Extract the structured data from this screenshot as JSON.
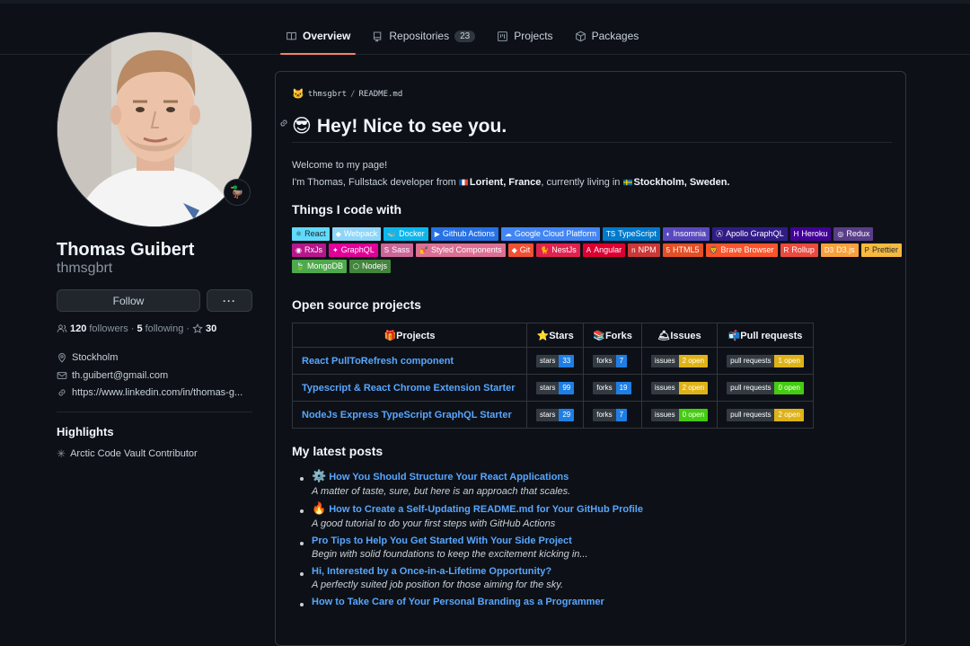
{
  "tabs": [
    {
      "label": "Overview",
      "icon": "book-icon"
    },
    {
      "label": "Repositories",
      "icon": "repo-icon",
      "count": "23"
    },
    {
      "label": "Projects",
      "icon": "project-icon"
    },
    {
      "label": "Packages",
      "icon": "package-icon"
    }
  ],
  "profile": {
    "name": "Thomas Guibert",
    "login": "thmsgbrt",
    "status_emoji": "🦆",
    "follow_label": "Follow",
    "more_label": "···",
    "followers_count": "120",
    "followers_label": "followers",
    "following_count": "5",
    "following_label": "following",
    "stars_count": "30",
    "location": "Stockholm",
    "email": "th.guibert@gmail.com",
    "website": "https://www.linkedin.com/in/thomas-g...",
    "highlights_title": "Highlights",
    "highlight_item": "Arctic Code Vault Contributor"
  },
  "readme": {
    "owner": "thmsgbrt",
    "file": "README.md",
    "heading_emoji": "😎",
    "heading": "Hey! Nice to see you.",
    "welcome": "Welcome to my page!",
    "intro_prefix": "I'm Thomas, Fullstack developer from",
    "origin": "Lorient, France",
    "intro_middle": ", currently living in",
    "current": "Stockholm, Sweden.",
    "things_title": "Things I code with",
    "badges": [
      {
        "label": "React",
        "color": "#20232a",
        "bg": "#61dafb",
        "icon": "⚛"
      },
      {
        "label": "Webpack",
        "bg": "#8dd6f9",
        "icon": "◆"
      },
      {
        "label": "Docker",
        "bg": "#0db7ed",
        "icon": "🐳"
      },
      {
        "label": "Github Actions",
        "bg": "#2671e5",
        "icon": "▶"
      },
      {
        "label": "Google Cloud Platform",
        "bg": "#4285f4",
        "icon": "☁"
      },
      {
        "label": "TypeScript",
        "bg": "#007acc",
        "icon": "TS"
      },
      {
        "label": "Insomnia",
        "bg": "#5849be",
        "icon": "◐"
      },
      {
        "label": "Apollo GraphQL",
        "bg": "#311c87",
        "icon": "Ⓐ"
      },
      {
        "label": "Heroku",
        "bg": "#430098",
        "icon": "H"
      },
      {
        "label": "Redux",
        "bg": "#593d88",
        "icon": "◎"
      },
      {
        "label": "RxJs",
        "bg": "#b7178c",
        "icon": "◉"
      },
      {
        "label": "GraphQL",
        "bg": "#e10098",
        "icon": "✦"
      },
      {
        "label": "Sass",
        "bg": "#cc6699",
        "icon": "S"
      },
      {
        "label": "Styled Components",
        "bg": "#db7093",
        "icon": "💅"
      },
      {
        "label": "Git",
        "bg": "#f05033",
        "icon": "◆"
      },
      {
        "label": "NestJs",
        "bg": "#e0234e",
        "icon": "🐈"
      },
      {
        "label": "Angular",
        "bg": "#dd0031",
        "icon": "A"
      },
      {
        "label": "NPM",
        "bg": "#cb3837",
        "icon": "n"
      },
      {
        "label": "HTML5",
        "bg": "#e34f26",
        "icon": "5"
      },
      {
        "label": "Brave Browser",
        "bg": "#fb542b",
        "icon": "🦁"
      },
      {
        "label": "Rollup",
        "bg": "#ec4a3f",
        "icon": "R"
      },
      {
        "label": "D3.js",
        "bg": "#f9a03c",
        "icon": "D3"
      },
      {
        "label": "Prettier",
        "bg": "#f7b93e",
        "color": "#1a2b34",
        "icon": "P"
      },
      {
        "label": "MongoDB",
        "bg": "#4ea94b",
        "icon": "🍃"
      },
      {
        "label": "Nodejs",
        "bg": "#43853d",
        "icon": "⬡"
      }
    ],
    "oss_title": "Open source projects",
    "table_headers": [
      {
        "emoji": "🎁",
        "label": "Projects"
      },
      {
        "emoji": "⭐",
        "label": "Stars"
      },
      {
        "emoji": "📚",
        "label": "Forks"
      },
      {
        "emoji": "🛎",
        "label": "Issues"
      },
      {
        "emoji": "📬",
        "label": "Pull requests"
      }
    ],
    "projects": [
      {
        "name": "React PullToRefresh component",
        "stars": "33",
        "forks": "7",
        "issues": "2 open",
        "issues_color": "#dfb317",
        "prs": "1 open",
        "prs_color": "#dfb317"
      },
      {
        "name": "Typescript & React Chrome Extension Starter",
        "stars": "99",
        "forks": "19",
        "issues": "2 open",
        "issues_color": "#dfb317",
        "prs": "0 open",
        "prs_color": "#4c1"
      },
      {
        "name": "NodeJs Express TypeScript GraphQL Starter",
        "stars": "29",
        "forks": "7",
        "issues": "0 open",
        "issues_color": "#4c1",
        "prs": "2 open",
        "prs_color": "#dfb317"
      }
    ],
    "shield_labels": {
      "stars": "stars",
      "forks": "forks",
      "issues": "issues",
      "prs": "pull requests"
    },
    "shield_count_color": "#1f7ee4",
    "posts_title": "My latest posts",
    "posts": [
      {
        "emoji": "⚙️",
        "title": "How You Should Structure Your React Applications",
        "desc": "A matter of taste, sure, but here is an approach that scales."
      },
      {
        "emoji": "🔥",
        "title": "How to Create a Self-Updating README.md for Your GitHub Profile",
        "desc": "A good tutorial to do your first steps with GitHub Actions"
      },
      {
        "emoji": "",
        "title": "Pro Tips to Help You Get Started With Your Side Project",
        "desc": "Begin with solid foundations to keep the excitement kicking in..."
      },
      {
        "emoji": "",
        "title": "Hi, Interested by a Once-in-a-Lifetime Opportunity?",
        "desc": "A perfectly suited job position for those aiming for the sky."
      },
      {
        "emoji": "",
        "title": "How to Take Care of Your Personal Branding as a Programmer",
        "desc": ""
      }
    ]
  }
}
